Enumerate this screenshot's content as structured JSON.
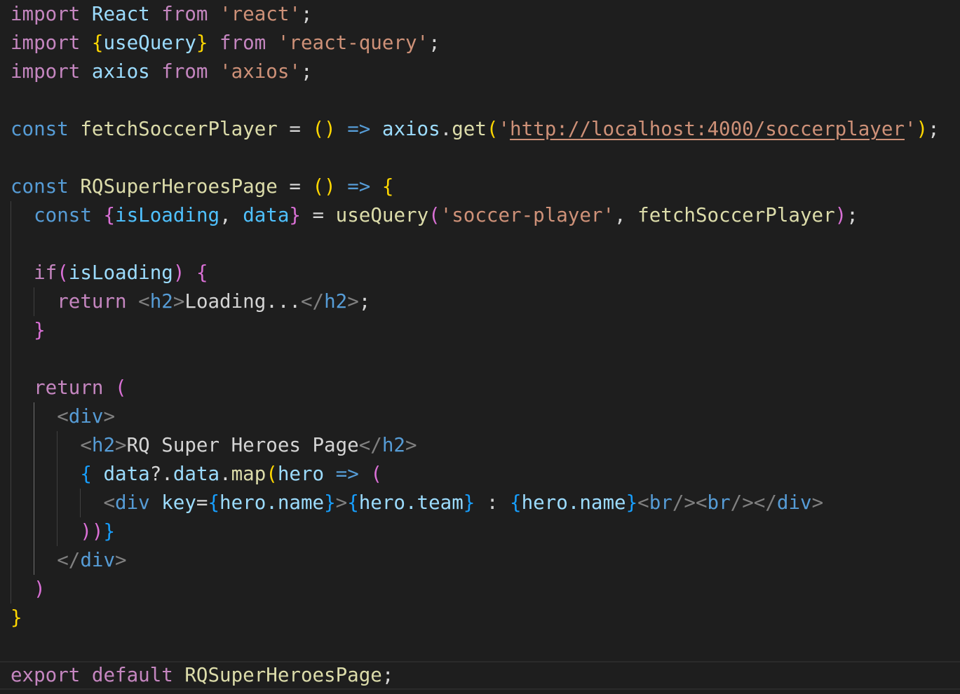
{
  "editor": {
    "language": "javascript-react",
    "theme_colors": {
      "background": "#1e1e1e",
      "keyword_control": "#c586c0",
      "keyword_storage": "#569cd6",
      "function": "#dcdcaa",
      "variable": "#9cdcfe",
      "constant": "#4fc1ff",
      "string": "#ce9178",
      "bracket_level_1": "#ffd700",
      "bracket_level_2": "#da70d6",
      "bracket_level_3": "#179fff"
    },
    "code": {
      "l1_import": "import",
      "l1_react": "React",
      "l1_from": "from",
      "l1_str": "'react'",
      "l1_semi": ";",
      "l2_import": "import",
      "l2_open": "{",
      "l2_usequery": "useQuery",
      "l2_close": "}",
      "l2_from": "from",
      "l2_str": "'react-query'",
      "l2_semi": ";",
      "l3_import": "import",
      "l3_axios": "axios",
      "l3_from": "from",
      "l3_str": "'axios'",
      "l3_semi": ";",
      "l5_const": "const",
      "l5_fetch": "fetchSoccerPlayer",
      "l5_eq": "=",
      "l5_parens": "()",
      "l5_arrow": "=>",
      "l5_axios": "axios",
      "l5_dot": ".",
      "l5_get": "get",
      "l5_popen": "(",
      "l5_q1": "'",
      "l5_url": "http://localhost:4000/soccerplayer",
      "l5_q2": "'",
      "l5_pclose": ")",
      "l5_semi": ";",
      "l7_const": "const",
      "l7_page": "RQSuperHeroesPage",
      "l7_eq": "=",
      "l7_parens": "()",
      "l7_arrow": "=>",
      "l7_brace": "{",
      "l8_const": "const",
      "l8_open": "{",
      "l8_isloading": "isLoading",
      "l8_comma": ",",
      "l8_data": "data",
      "l8_close": "}",
      "l8_eq": "=",
      "l8_usequery": "useQuery",
      "l8_popen": "(",
      "l8_str": "'soccer-player'",
      "l8_comma2": ",",
      "l8_fetch": "fetchSoccerPlayer",
      "l8_pclose": ")",
      "l8_semi": ";",
      "l10_if": "if",
      "l10_popen": "(",
      "l10_isloading": "isLoading",
      "l10_pclose": ")",
      "l10_brace": "{",
      "l11_return": "return",
      "l11_lt1": "<",
      "l11_h2a": "h2",
      "l11_gt1": ">",
      "l11_text": "Loading...",
      "l11_lt2": "</",
      "l11_h2b": "h2",
      "l11_gt2": ">",
      "l11_semi": ";",
      "l12_brace": "}",
      "l14_return": "return",
      "l14_paren": "(",
      "l15_lt": "<",
      "l15_div": "div",
      "l15_gt": ">",
      "l16_lt1": "<",
      "l16_h2a": "h2",
      "l16_gt1": ">",
      "l16_text": "RQ Super Heroes Page",
      "l16_lt2": "</",
      "l16_h2b": "h2",
      "l16_gt2": ">",
      "l17_brace": "{",
      "l17_data": "data",
      "l17_opt": "?.",
      "l17_data2": "data",
      "l17_dot": ".",
      "l17_map": "map",
      "l17_popen": "(",
      "l17_hero": "hero",
      "l17_arrow": "=>",
      "l17_paren": "(",
      "l18_lt1": "<",
      "l18_div": "div",
      "l18_key": "key",
      "l18_eq": "=",
      "l18_o1": "{",
      "l18_heroname1": "hero.name",
      "l18_c1": "}",
      "l18_gt1": ">",
      "l18_o2": "{",
      "l18_heroteam": "hero.team",
      "l18_c2": "}",
      "l18_colon": " : ",
      "l18_o3": "{",
      "l18_heroname2": "hero.name",
      "l18_c3": "}",
      "l18_br1a": "<",
      "l18_br1": "br",
      "l18_br1b": "/>",
      "l18_br2a": "<",
      "l18_br2": "br",
      "l18_br2b": "/>",
      "l18_end1": "</",
      "l18_enddiv": "div",
      "l18_end2": ">",
      "l19_close2": "))",
      "l19_brace": "}",
      "l20_lt": "</",
      "l20_div": "div",
      "l20_gt": ">",
      "l21_paren": ")",
      "l22_brace": "}",
      "l24_export": "export",
      "l24_default": "default",
      "l24_page": "RQSuperHeroesPage",
      "l24_semi": ";"
    }
  }
}
